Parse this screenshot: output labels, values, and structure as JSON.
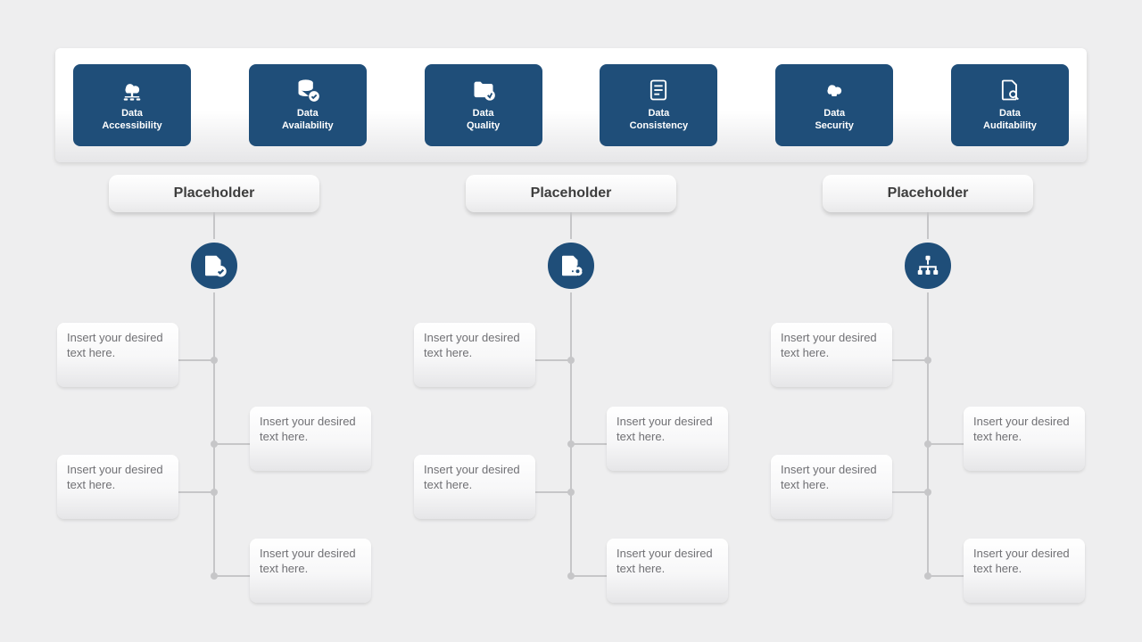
{
  "colors": {
    "brand": "#1f4e79",
    "canvas": "#eeeeef"
  },
  "top_categories": [
    {
      "line1": "Data",
      "line2": "Accessibility",
      "icon": "cloud-network-icon"
    },
    {
      "line1": "Data",
      "line2": "Availability",
      "icon": "database-check-icon"
    },
    {
      "line1": "Data",
      "line2": "Quality",
      "icon": "folder-arrow-icon"
    },
    {
      "line1": "Data",
      "line2": "Consistency",
      "icon": "document-list-icon"
    },
    {
      "line1": "Data",
      "line2": "Security",
      "icon": "cloud-lock-icon"
    },
    {
      "line1": "Data",
      "line2": "Auditability",
      "icon": "document-search-icon"
    }
  ],
  "columns": [
    {
      "title": "Placeholder",
      "icon": "document-check-icon",
      "notes": [
        "Insert your desired text here.",
        "Insert your desired text here.",
        "Insert your desired text here.",
        "Insert your desired text here."
      ]
    },
    {
      "title": "Placeholder",
      "icon": "document-gear-icon",
      "notes": [
        "Insert your desired text here.",
        "Insert your desired text here.",
        "Insert your desired text here.",
        "Insert your desired text here."
      ]
    },
    {
      "title": "Placeholder",
      "icon": "org-chart-icon",
      "notes": [
        "Insert your desired text here.",
        "Insert your desired text here.",
        "Insert your desired text here.",
        "Insert your desired text here."
      ]
    }
  ]
}
